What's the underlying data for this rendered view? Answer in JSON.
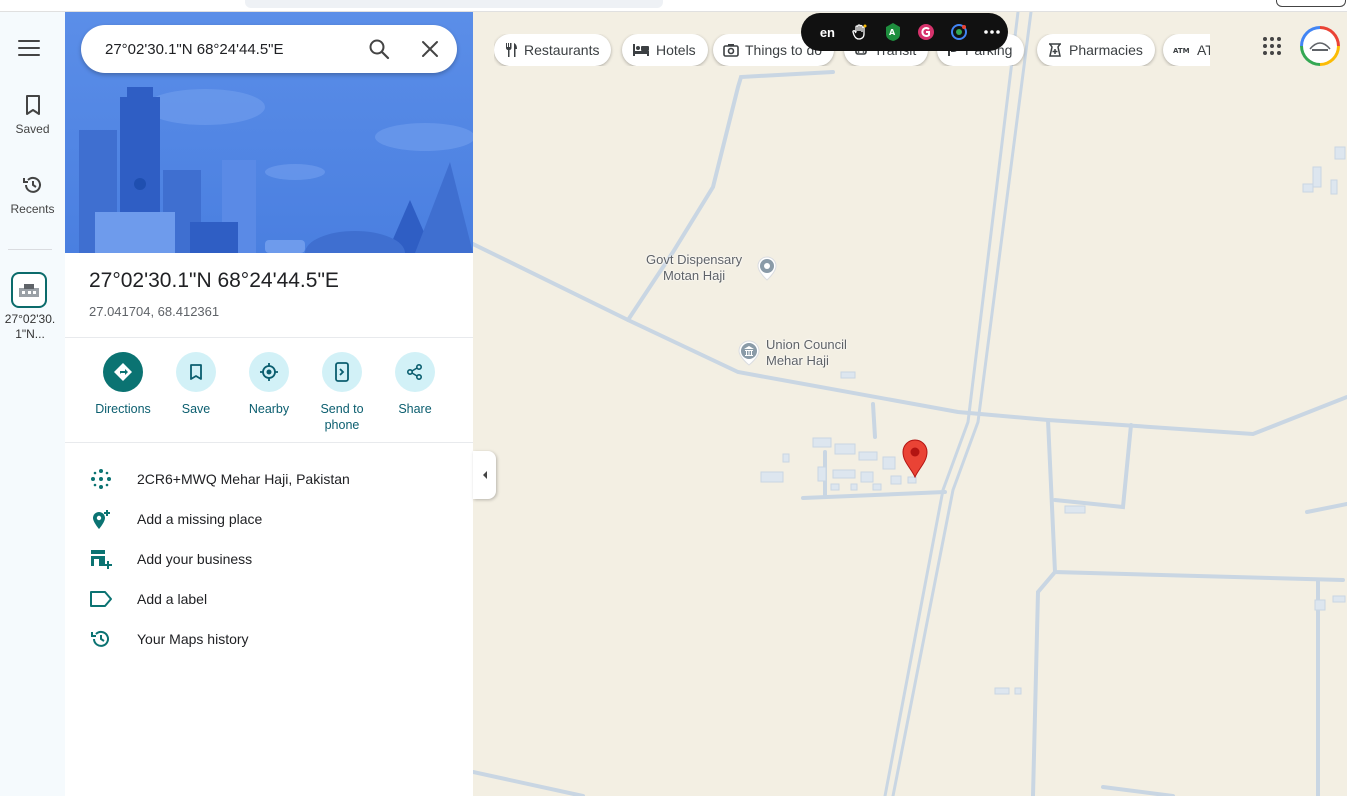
{
  "search": {
    "value": "27°02'30.1\"N 68°24'44.5\"E"
  },
  "rail": {
    "saved": "Saved",
    "recents": "Recents",
    "recent_item": "27°02'30. 1\"N..."
  },
  "place": {
    "title": "27°02'30.1\"N 68°24'44.5\"E",
    "decimal": "27.041704, 68.412361"
  },
  "actions": {
    "directions": "Directions",
    "save": "Save",
    "nearby": "Nearby",
    "send_line1": "Send to",
    "send_line2": "phone",
    "share": "Share"
  },
  "info": {
    "plus_code": "2CR6+MWQ Mehar Haji, Pakistan",
    "add_missing": "Add a missing place",
    "add_business": "Add your business",
    "add_label": "Add a label",
    "history": "Your Maps history"
  },
  "chips": {
    "restaurants": "Restaurants",
    "hotels": "Hotels",
    "things": "Things to do",
    "transit": "Transit",
    "parking": "Parking",
    "pharmacies": "Pharmacies",
    "atm": "ATMs"
  },
  "toolbar": {
    "lang": "en"
  },
  "map": {
    "poi1_line1": "Govt Dispensary",
    "poi1_line2": "Motan Haji",
    "poi2_line1": "Union Council",
    "poi2_line2": "Mehar Haji"
  },
  "colors": {
    "accent": "#0b7372",
    "hero": "#4a7fe0",
    "pin": "#ea4335",
    "road": "#c9d6e3",
    "land": "#f3efe3"
  }
}
